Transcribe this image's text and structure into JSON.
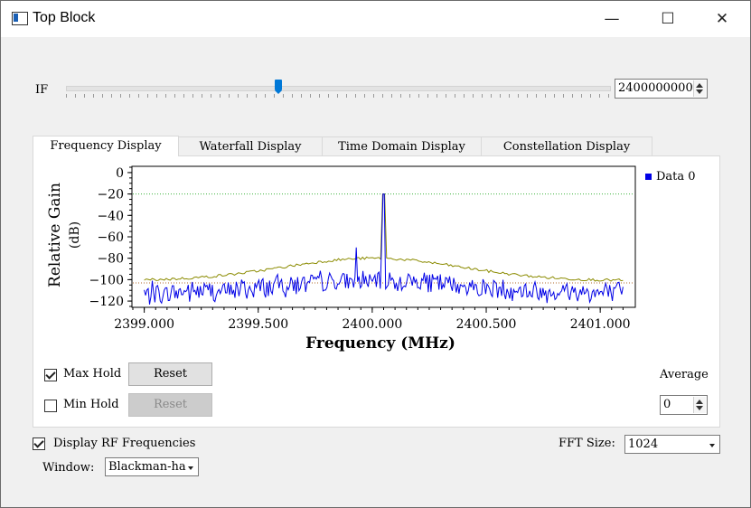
{
  "window": {
    "title": "Top Block",
    "minimize_glyph": "—",
    "maximize_glyph": "☐",
    "close_glyph": "✕"
  },
  "if_control": {
    "label": "IF",
    "value": "2400000000",
    "slider_fraction": 0.39
  },
  "tabs": [
    {
      "label": "Frequency Display",
      "active": true
    },
    {
      "label": "Waterfall Display",
      "active": false
    },
    {
      "label": "Time Domain Display",
      "active": false
    },
    {
      "label": "Constellation Display",
      "active": false
    }
  ],
  "controls": {
    "max_hold": {
      "label": "Max Hold",
      "checked": true
    },
    "max_reset": "Reset",
    "min_hold": {
      "label": "Min Hold",
      "checked": false
    },
    "min_reset": "Reset",
    "average_label": "Average",
    "average_value": "0"
  },
  "bottom": {
    "display_rf": {
      "label": "Display RF Frequencies",
      "checked": true
    },
    "fft_label": "FFT Size:",
    "fft_value": "1024",
    "window_label": "Window:",
    "window_value": "Blackman-ha"
  },
  "colors": {
    "trace": "#0000e6",
    "max_hold": "#8b8b00",
    "threshold_line": "#3cb43c",
    "min_line": "#b06a2a",
    "accent": "#0078d7"
  },
  "chart_data": {
    "type": "line",
    "xlabel": "Frequency (MHz)",
    "ylabel": "Relative Gain (dB)",
    "xlim": [
      2398.95,
      2401.15
    ],
    "ylim": [
      -125,
      5
    ],
    "xticks": [
      "2399.000",
      "2399.500",
      "2400.000",
      "2400.500",
      "2401.000"
    ],
    "xtick_values": [
      2399.0,
      2399.5,
      2400.0,
      2400.5,
      2401.0
    ],
    "yticks": [
      0,
      -20,
      -40,
      -60,
      -80,
      -100,
      -120
    ],
    "reference_lines": {
      "upper": -20,
      "lower": -103
    },
    "series": [
      {
        "name": "Data 0",
        "role": "trace",
        "noise_floor": -110,
        "noise_hump": 12,
        "peaks": [
          {
            "x": 2400.05,
            "y": -20
          },
          {
            "x": 2400.04,
            "y": -67
          },
          {
            "x": 2399.93,
            "y": -70
          }
        ]
      },
      {
        "role": "max_hold",
        "floor": -101,
        "hump": 21,
        "peak": {
          "x": 2400.05,
          "y": -20
        }
      }
    ],
    "legend": "top-right",
    "grid": false
  }
}
